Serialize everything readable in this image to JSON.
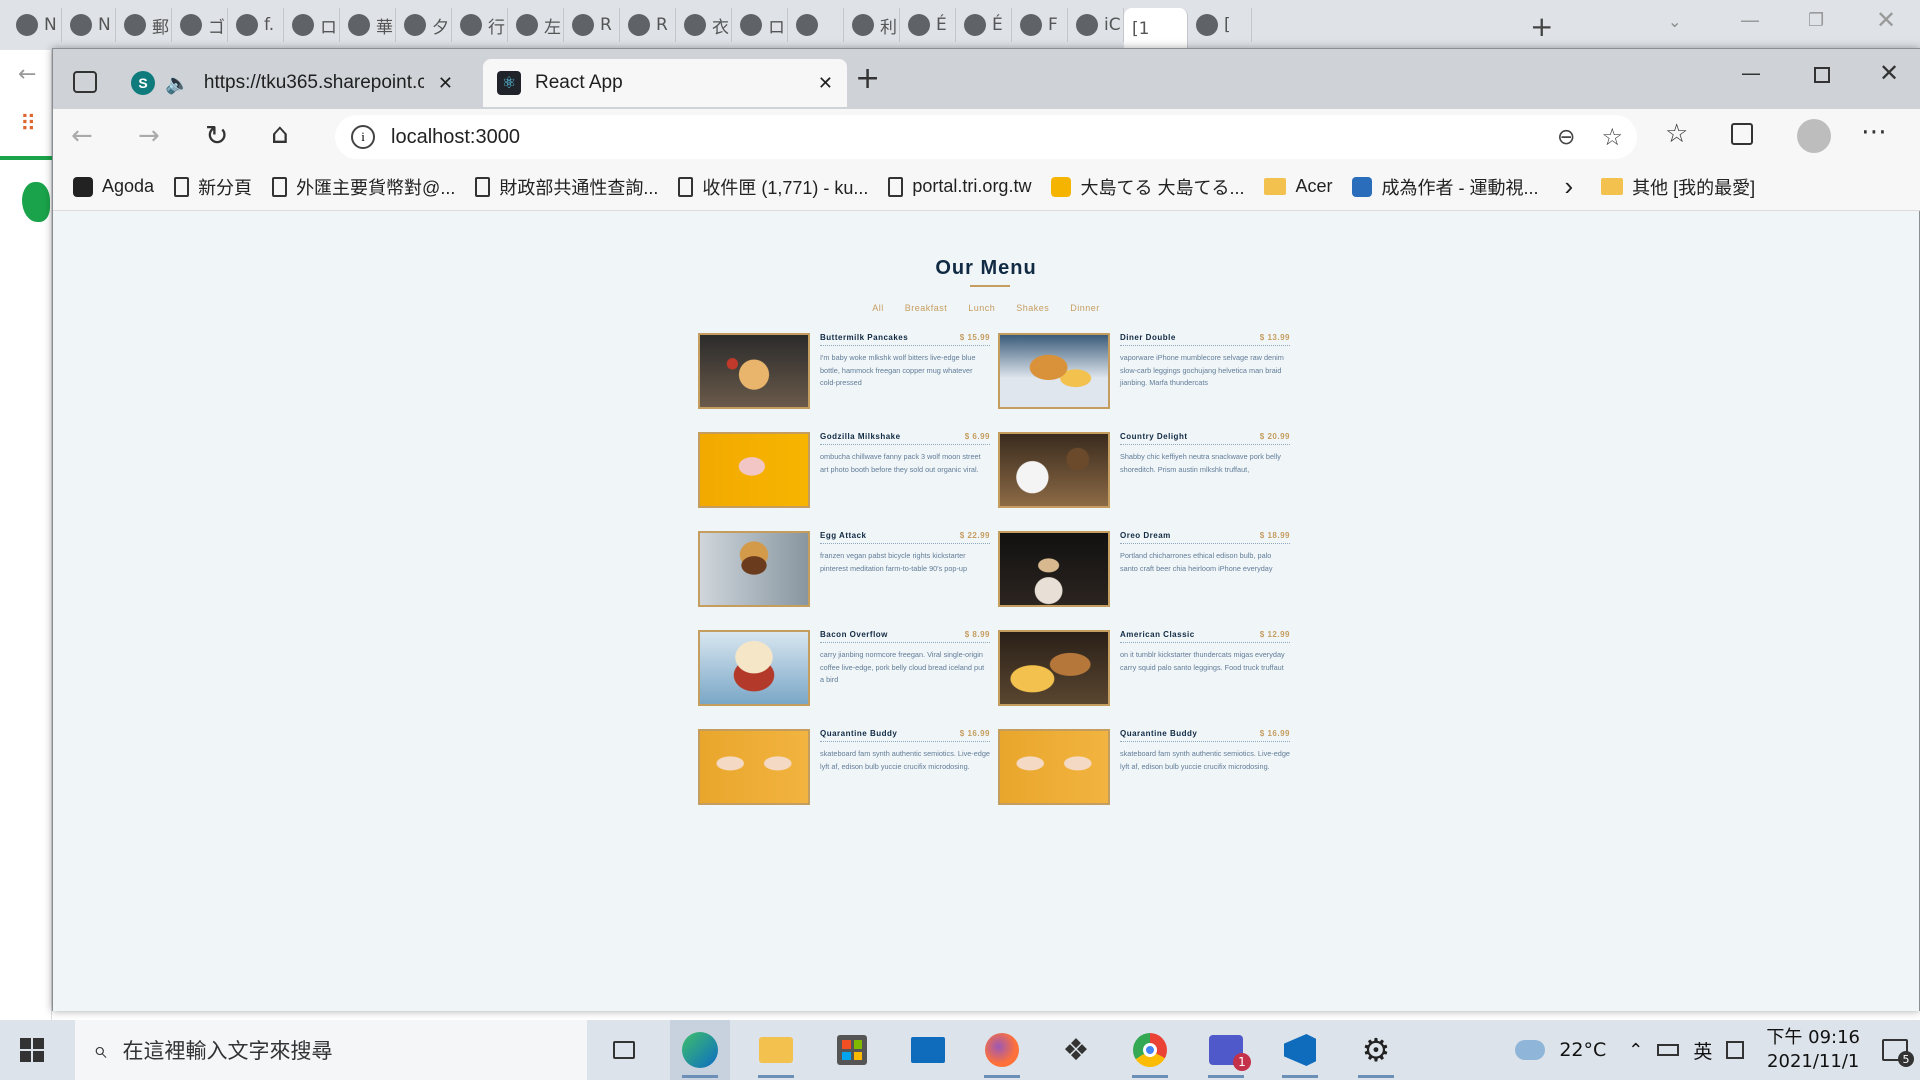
{
  "background_tabs": [
    {
      "label": "N",
      "icon": "note-icon"
    },
    {
      "label": "N",
      "icon": "note-icon"
    },
    {
      "label": "郵",
      "icon": "globe-icon"
    },
    {
      "label": "ゴ",
      "icon": "owl-icon"
    },
    {
      "label": "f.",
      "icon": "globe-icon"
    },
    {
      "label": "ロ",
      "icon": "globe-icon"
    },
    {
      "label": "華",
      "icon": "globe-icon"
    },
    {
      "label": "夕",
      "icon": "globe-icon"
    },
    {
      "label": "行",
      "icon": "google-icon"
    },
    {
      "label": "左",
      "icon": "app-icon"
    },
    {
      "label": "R",
      "icon": "globe-icon"
    },
    {
      "label": "R",
      "icon": "globe-icon"
    },
    {
      "label": "衣",
      "icon": "globe-icon"
    },
    {
      "label": "ロ",
      "icon": "globe-icon"
    },
    {
      "label": "",
      "icon": "gmail-icon"
    },
    {
      "label": "利",
      "icon": "app-icon"
    },
    {
      "label": "É",
      "icon": "globe-icon"
    },
    {
      "label": "É",
      "icon": "globe-icon"
    },
    {
      "label": "F",
      "icon": "globe-icon"
    },
    {
      "label": "iC",
      "icon": "pen-icon"
    },
    {
      "label": "[1",
      "icon": ""
    },
    {
      "label": "[",
      "icon": "evernote-icon"
    }
  ],
  "browser": {
    "tabs": [
      {
        "label": "https://tku365.sharepoint.cc",
        "icon": "sharepoint-icon"
      },
      {
        "label": "React App",
        "icon": "react-icon"
      }
    ],
    "url": "localhost:3000",
    "favorites": [
      {
        "label": "Agoda",
        "icon": "amazon-icon"
      },
      {
        "label": "新分頁",
        "icon": "doc-icon"
      },
      {
        "label": "外匯主要貨幣對@...",
        "icon": "doc-icon"
      },
      {
        "label": "財政部共通性查詢...",
        "icon": "doc-icon"
      },
      {
        "label": "收件匣 (1,771) - ku...",
        "icon": "doc-icon"
      },
      {
        "label": "portal.tri.org.tw",
        "icon": "doc-icon"
      },
      {
        "label": "大島てる 大島てる...",
        "icon": "flame-icon"
      },
      {
        "label": "Acer",
        "icon": "folder-icon"
      },
      {
        "label": "成為作者 - 運動視...",
        "icon": "pen-icon"
      }
    ],
    "other_favorites": "其他 [我的最愛]"
  },
  "page": {
    "title": "Our Menu",
    "filters": [
      "All",
      "Breakfast",
      "Lunch",
      "Shakes",
      "Dinner"
    ],
    "items": [
      {
        "name": "Buttermilk Pancakes",
        "price": "$ 15.99",
        "desc": "I'm baby woke mlkshk wolf bitters live-edge blue bottle, hammock freegan copper mug whatever cold-pressed"
      },
      {
        "name": "Diner Double",
        "price": "$ 13.99",
        "desc": "vaporware iPhone mumblecore selvage raw denim slow-carb leggings gochujang helvetica man braid jianbing. Marfa thundercats"
      },
      {
        "name": "Godzilla Milkshake",
        "price": "$ 6.99",
        "desc": "ombucha chillwave fanny pack 3 wolf moon street art photo booth before they sold out organic viral."
      },
      {
        "name": "Country Delight",
        "price": "$ 20.99",
        "desc": "Shabby chic keffiyeh neutra snackwave pork belly shoreditch. Prism austin mlkshk truffaut,"
      },
      {
        "name": "Egg Attack",
        "price": "$ 22.99",
        "desc": "franzen vegan pabst bicycle rights kickstarter pinterest meditation farm-to-table 90's pop-up"
      },
      {
        "name": "Oreo Dream",
        "price": "$ 18.99",
        "desc": "Portland chicharrones ethical edison bulb, palo santo craft beer chia heirloom iPhone everyday"
      },
      {
        "name": "Bacon Overflow",
        "price": "$ 8.99",
        "desc": "carry jianbing normcore freegan. Viral single-origin coffee live-edge, pork belly cloud bread iceland put a bird"
      },
      {
        "name": "American Classic",
        "price": "$ 12.99",
        "desc": "on it tumblr kickstarter thundercats migas everyday carry squid palo santo leggings. Food truck truffaut"
      },
      {
        "name": "Quarantine Buddy",
        "price": "$ 16.99",
        "desc": "skateboard fam synth authentic semiotics. Live-edge lyft af, edison bulb yuccie crucifix microdosing."
      },
      {
        "name": "Quarantine Buddy",
        "price": "$ 16.99",
        "desc": "skateboard fam synth authentic semiotics. Live-edge lyft af, edison bulb yuccie crucifix microdosing."
      }
    ]
  },
  "taskbar": {
    "search_placeholder": "在這裡輸入文字來搜尋",
    "weather": "22°C",
    "ime": "英",
    "time": "下午 09:16",
    "date": "2021/11/1",
    "notification_count": "5",
    "teams_badge": "1"
  }
}
